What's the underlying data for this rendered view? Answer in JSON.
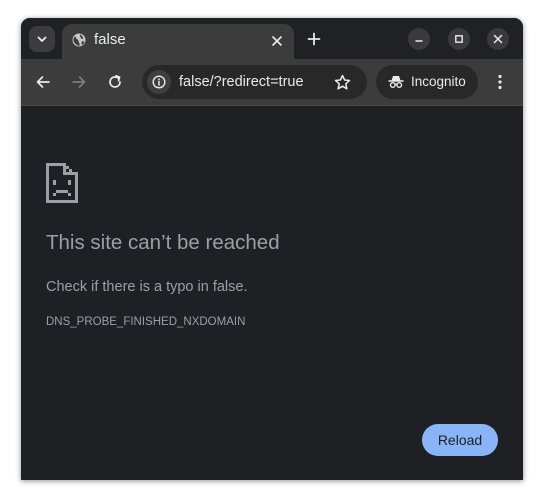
{
  "tab": {
    "title": "false",
    "favicon_icon": "globe-icon",
    "close_icon": "close-icon"
  },
  "tabstrip": {
    "tab_search_icon": "chevron-down-icon",
    "new_tab_icon": "plus-icon",
    "window_controls": [
      "minimize-icon",
      "maximize-icon",
      "close-icon"
    ]
  },
  "toolbar": {
    "back_icon": "arrow-left-icon",
    "forward_icon": "arrow-right-icon",
    "reload_icon": "reload-icon",
    "site_info_icon": "info-icon",
    "url": "false/?redirect=true",
    "bookmark_icon": "star-icon",
    "incognito_label": "Incognito",
    "incognito_icon": "incognito-icon",
    "menu_icon": "more-vertical-icon"
  },
  "error_page": {
    "icon": "sad-page-icon",
    "title": "This site can’t be reached",
    "description": "Check if there is a typo in false.",
    "error_code": "DNS_PROBE_FINISHED_NXDOMAIN",
    "reload_label": "Reload"
  },
  "colors": {
    "content_bg": "#1f2023",
    "toolbar_bg": "#3c3c3c",
    "accent": "#8ab4f8",
    "text_muted": "#9aa0a6"
  }
}
